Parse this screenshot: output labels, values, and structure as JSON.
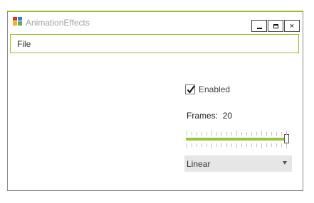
{
  "window": {
    "title": "AnimationEffects"
  },
  "controls": {
    "minimize_icon": "minimize-icon",
    "maximize_icon": "maximize-icon",
    "close_label": "×"
  },
  "menu": {
    "items": [
      {
        "label": "File"
      }
    ]
  },
  "animation": {
    "enabled": {
      "label": "Enabled",
      "checked": true
    },
    "frames": {
      "label": "Frames:",
      "value": "20"
    },
    "slider": {
      "value": 20,
      "min": 0,
      "max": 20
    },
    "easing": {
      "selected": "Linear"
    }
  },
  "colors": {
    "accent": "#9bbb2e",
    "track": "#9bc43a"
  }
}
